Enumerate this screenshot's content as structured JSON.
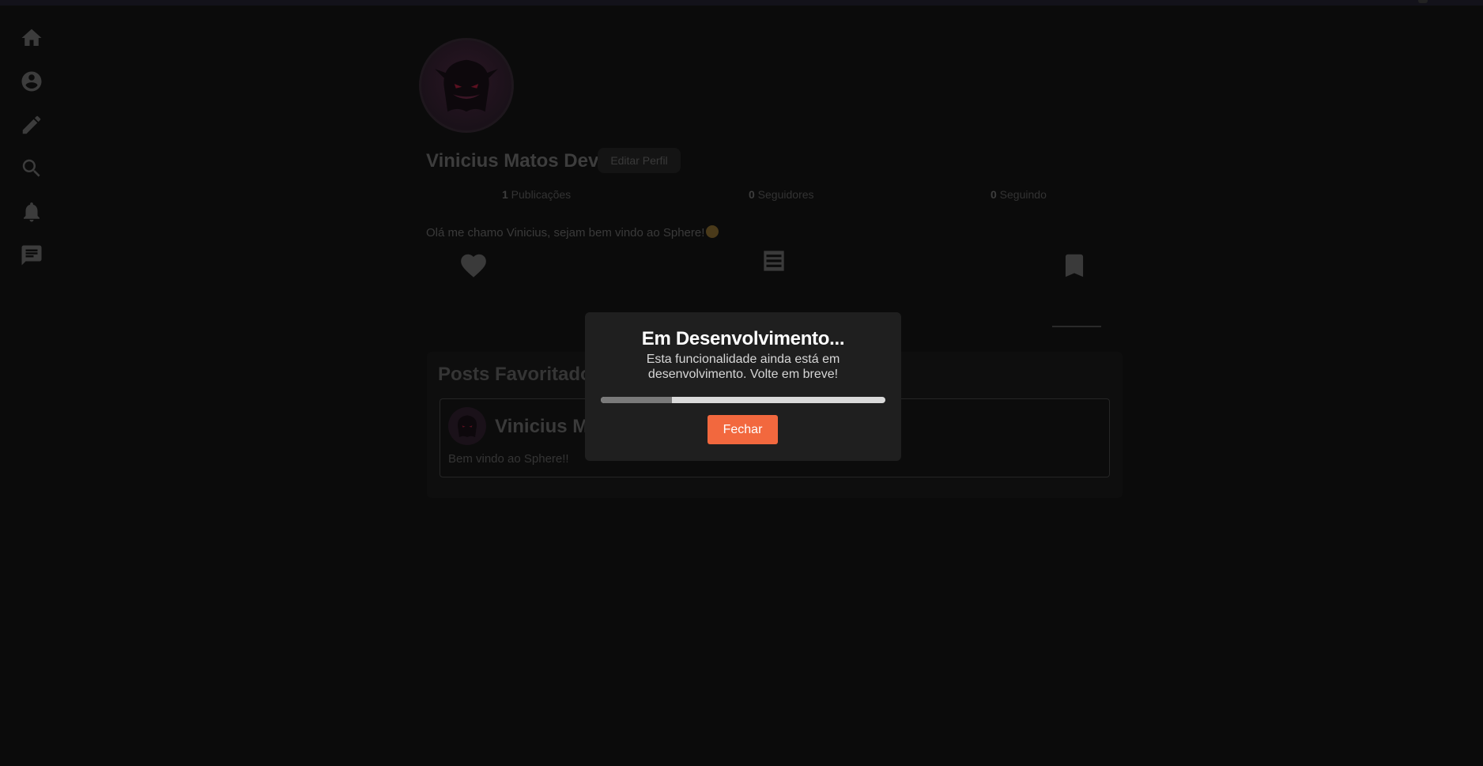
{
  "sidebar": {
    "items": [
      {
        "icon": "home-icon"
      },
      {
        "icon": "account-circle-icon"
      },
      {
        "icon": "pencil-icon"
      },
      {
        "icon": "search-icon"
      },
      {
        "icon": "bell-icon"
      },
      {
        "icon": "chat-icon"
      }
    ]
  },
  "profile": {
    "name": "Vinicius Matos Dev",
    "edit_label": "Editar Perfil",
    "stats": {
      "posts_count": "1",
      "posts_label": " Publicações",
      "followers_count": "0",
      "followers_label": " Seguidores",
      "following_count": "0",
      "following_label": " Seguindo"
    },
    "bio": "Olá me chamo Vinicius, sejam bem vindo ao Sphere!"
  },
  "tabs": [
    {
      "icon": "heart-icon"
    },
    {
      "icon": "list-icon"
    },
    {
      "icon": "bookmark-icon",
      "active": true
    }
  ],
  "favorites": {
    "title": "Posts Favoritados",
    "post": {
      "author": "Vinicius Matos Dev",
      "text": "Bem vindo ao Sphere!!"
    }
  },
  "modal": {
    "title": "Em Desenvolvimento...",
    "body": "Esta funcionalidade ainda está em desenvolvimento. Volte em breve!",
    "progress": 0.25,
    "close_label": "Fechar"
  },
  "colors": {
    "accent": "#f2683e",
    "background": "#0b0b0b",
    "modal_bg": "#1f1f1f"
  }
}
